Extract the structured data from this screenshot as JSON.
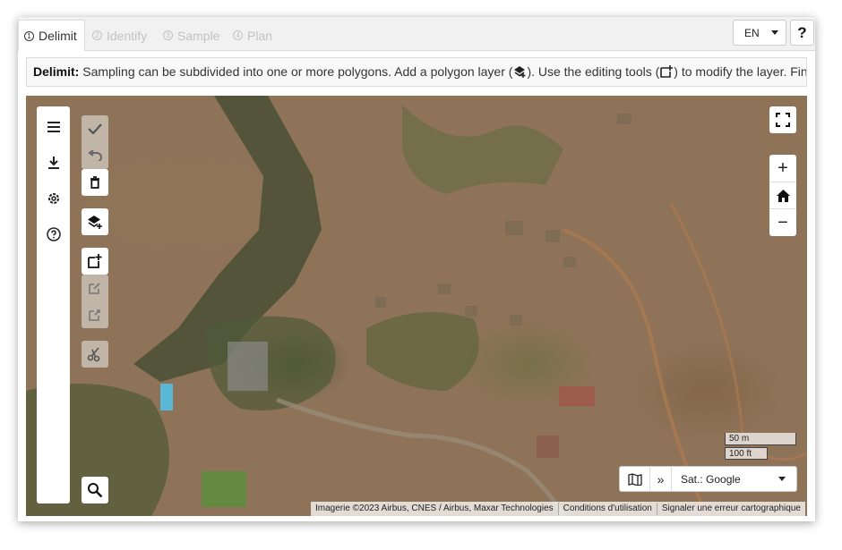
{
  "tabs": [
    {
      "number": "1",
      "label": "Delimit"
    },
    {
      "number": "2",
      "label": "Identify"
    },
    {
      "number": "3",
      "label": "Sample"
    },
    {
      "number": "4",
      "label": "Plan"
    }
  ],
  "language": {
    "selected": "EN"
  },
  "help_label": "?",
  "info": {
    "title": "Delimit:",
    "text_1": "Sampling can be subdivided into one or more polygons. Add a polygon layer (",
    "text_2": "). Use the editing tools (",
    "text_3": ") to modify the layer. Fina"
  },
  "map": {
    "scale": {
      "metric": "50 m",
      "imperial": "100 ft"
    },
    "base_layer": {
      "selected": "Sat.: Google"
    },
    "attribution": [
      "Imagerie ©2023 Airbus, CNES / Airbus, Maxar Technologies",
      "Conditions d'utilisation",
      "Signaler une erreur cartographique"
    ],
    "zoom_in_label": "+",
    "zoom_out_label": "−"
  },
  "icons": {
    "menu": "menu-icon",
    "download": "download-icon",
    "settings": "gear-icon",
    "help": "help-circle-icon",
    "confirm": "check-icon",
    "undo": "undo-icon",
    "delete": "trash-icon",
    "add_layer": "layers-add-icon",
    "add_polygon": "polygon-add-icon",
    "edit": "edit-icon",
    "cut": "scissors-icon",
    "search": "search-icon",
    "fullscreen": "fullscreen-icon",
    "home": "home-icon",
    "base_map": "map-icon",
    "expand": "double-chevron-icon"
  },
  "colors": {
    "active_text": "#333333",
    "inactive_text": "#c2c2c2",
    "tab_bar": "#f1f1f1"
  }
}
